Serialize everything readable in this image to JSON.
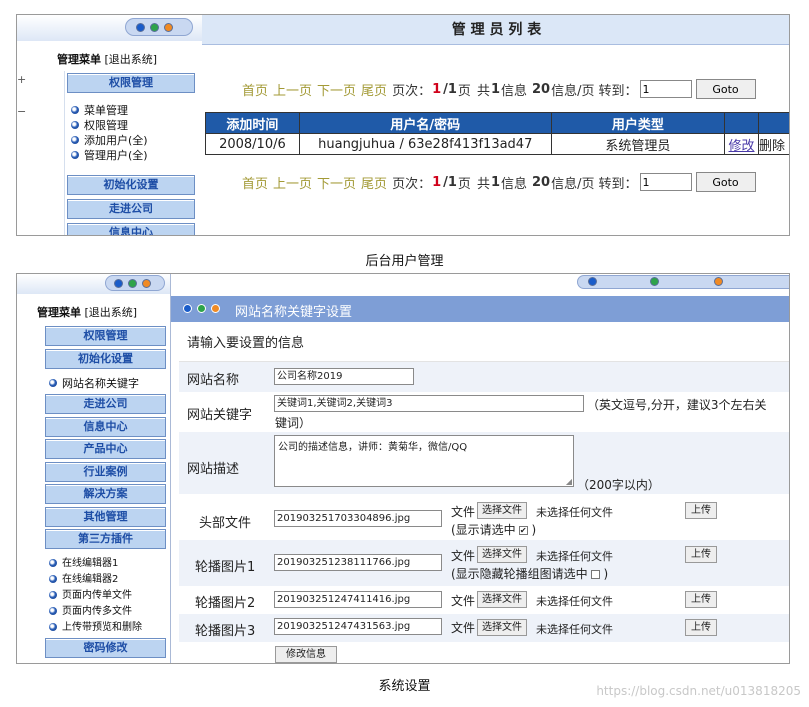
{
  "panel1": {
    "sidebar": {
      "menu_title": "管理菜单",
      "logout": "[退出系统]",
      "section_permission": "权限管理",
      "permission_items": [
        "菜单管理",
        "权限管理",
        "添加用户(全)",
        "管理用户(全)"
      ],
      "btn_init": "初始化设置",
      "btn_about": "走进公司",
      "btn_news": "信息中心"
    },
    "title": "管 理 员 列 表",
    "pager": {
      "first": "首页",
      "prev": "上一页",
      "next": "下一页",
      "last": "尾页",
      "page_label": "页次：",
      "page_cur": "1",
      "page_total": "/1",
      "page_unit": "页",
      "total_label": "共",
      "total_count": "1",
      "total_unit": "信息",
      "per_page": "20",
      "per_page_unit": "信息/页",
      "goto_label": "转到：",
      "goto_value": "1",
      "goto_button": "Goto"
    },
    "table": {
      "headers": [
        "添加时间",
        "用户名/密码",
        "用户类型",
        "",
        ""
      ],
      "row": {
        "date": "2008/10/6",
        "user": "huangjuhua / 63e28f413f13ad47",
        "type": "系统管理员",
        "edit": "修改",
        "delete": "删除"
      }
    },
    "caption": "后台用户管理"
  },
  "panel2": {
    "sidebar": {
      "menu_title": "管理菜单",
      "logout": "[退出系统]",
      "btn_permission": "权限管理",
      "btn_init": "初始化设置",
      "init_items": [
        "网站名称关键字"
      ],
      "btn_about": "走进公司",
      "btn_news": "信息中心",
      "btn_products": "产品中心",
      "btn_cases": "行业案例",
      "btn_solutions": "解决方案",
      "btn_other": "其他管理",
      "btn_plugins": "第三方插件",
      "plugin_items": [
        "在线编辑器1",
        "在线编辑器2",
        "页面内传单文件",
        "页面内传多文件",
        "上传带预览和删除"
      ],
      "btn_password": "密码修改"
    },
    "header_title": "网站名称关键字设置",
    "intro": "请输入要设置的信息",
    "form": {
      "site_name_label": "网站名称",
      "site_name_value": "公司名称2019",
      "keywords_label": "网站关键字",
      "keywords_value": "关键词1,关键词2,关键词3",
      "keywords_note_1": "（英文逗号,分开，建议3个左右关",
      "keywords_note_2": "键词）",
      "desc_label": "网站描述",
      "desc_value": "公司的描述信息，讲师：黄菊华，微信/QQ",
      "desc_note": "（200字以内）",
      "file_word": "文件",
      "choose_file": "选择文件",
      "no_file": "未选择任何文件",
      "upload": "上传",
      "header_file_label": "头部文件",
      "header_file_value": "201903251703304896.jpg",
      "header_file_note": "(显示请选中",
      "carousel1_label": "轮播图片1",
      "carousel1_value": "201903251238111766.jpg",
      "carousel1_note": "(显示隐藏轮播组图请选中",
      "carousel2_label": "轮播图片2",
      "carousel2_value": "201903251247411416.jpg",
      "carousel3_label": "轮播图片3",
      "carousel3_value": "201903251247431563.jpg",
      "submit": "修改信息",
      "close_paren": ")"
    },
    "caption": "系统设置"
  },
  "watermark": "https://blog.csdn.net/u013818205"
}
